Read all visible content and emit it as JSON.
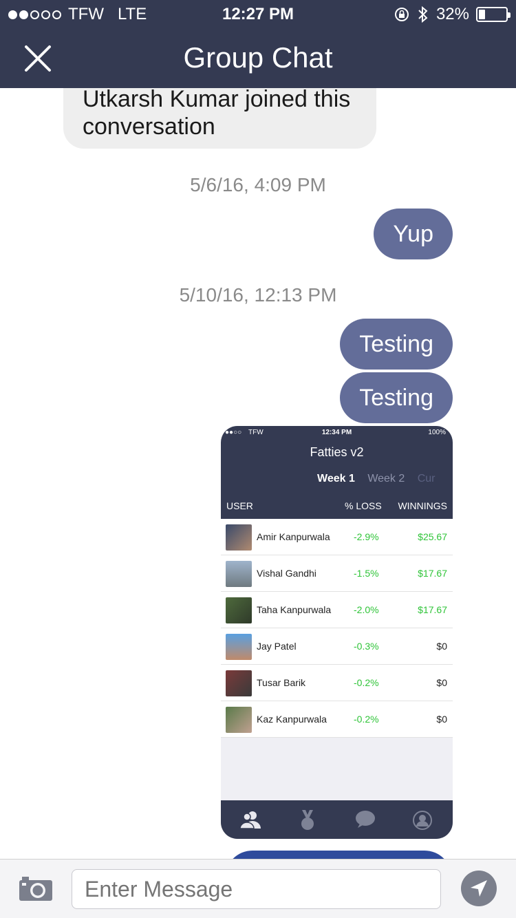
{
  "status_bar": {
    "carrier": "TFW",
    "network": "LTE",
    "time": "12:27 PM",
    "battery": "32%",
    "battery_level": 0.32,
    "signal_bars": 2
  },
  "nav": {
    "title": "Group Chat"
  },
  "messages": {
    "system": "Utkarsh Kumar joined this conversation",
    "ts1": "5/6/16, 4:09 PM",
    "m1": "Yup",
    "ts2": "5/10/16, 12:13 PM",
    "m2": "Testing",
    "m3": "Testing"
  },
  "attachment": {
    "status": {
      "carrier": "TFW",
      "time": "12:34 PM",
      "battery": "100%"
    },
    "title": "Fatties v2",
    "weeks": [
      "Week 1",
      "Week 2",
      "Cur"
    ],
    "columns": {
      "user": "USER",
      "loss": "% LOSS",
      "winnings": "WINNINGS"
    },
    "rows": [
      {
        "name": "Amir Kanpurwala",
        "loss": "-2.9%",
        "winnings": "$25.67"
      },
      {
        "name": "Vishal Gandhi",
        "loss": "-1.5%",
        "winnings": "$17.67"
      },
      {
        "name": "Taha Kanpurwala",
        "loss": "-2.0%",
        "winnings": "$17.67"
      },
      {
        "name": "Jay Patel",
        "loss": "-0.3%",
        "winnings": "$0"
      },
      {
        "name": "Tusar Barik",
        "loss": "-0.2%",
        "winnings": "$0"
      },
      {
        "name": "Kaz Kanpurwala",
        "loss": "-0.2%",
        "winnings": "$0"
      }
    ],
    "tabs": [
      "users-icon",
      "medal-icon",
      "chat-bubble-icon",
      "profile-icon"
    ]
  },
  "input": {
    "placeholder": "Enter Message",
    "value": ""
  },
  "colors": {
    "header": "#343a52",
    "bubble_out": "#636d99",
    "gain": "#2fc438"
  }
}
